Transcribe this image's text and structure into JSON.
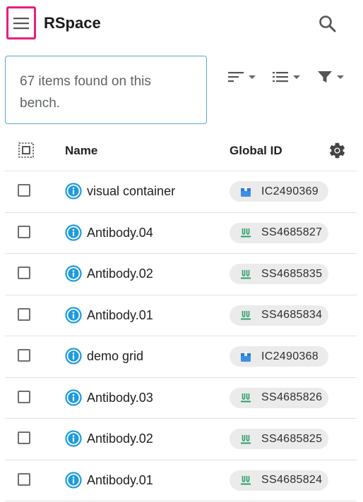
{
  "header": {
    "title": "RSpace",
    "menu_icon": "hamburger-menu-icon",
    "search_icon": "search-icon"
  },
  "results": {
    "text": "67 items found on this bench."
  },
  "toolbar": {
    "sort_icon": "sort-icon",
    "view_icon": "list-view-icon",
    "filter_icon": "filter-icon"
  },
  "table": {
    "columns": {
      "name": "Name",
      "global_id": "Global ID"
    },
    "settings_icon": "gear-icon",
    "rows": [
      {
        "name": "visual container",
        "global_id": "IC2490369",
        "type": "container"
      },
      {
        "name": "Antibody.04",
        "global_id": "SS4685827",
        "type": "subsample"
      },
      {
        "name": "Antibody.02",
        "global_id": "SS4685835",
        "type": "subsample"
      },
      {
        "name": "Antibody.01",
        "global_id": "SS4685834",
        "type": "subsample"
      },
      {
        "name": "demo grid",
        "global_id": "IC2490368",
        "type": "container"
      },
      {
        "name": "Antibody.03",
        "global_id": "SS4685826",
        "type": "subsample"
      },
      {
        "name": "Antibody.02",
        "global_id": "SS4685825",
        "type": "subsample"
      },
      {
        "name": "Antibody.01",
        "global_id": "SS4685824",
        "type": "subsample"
      }
    ]
  },
  "colors": {
    "highlight": "#e5207a",
    "info_blue": "#1e9be0",
    "container_blue": "#3d8ee6",
    "subsample_green": "#2e9e6a",
    "chip_bg": "#ebebeb"
  }
}
